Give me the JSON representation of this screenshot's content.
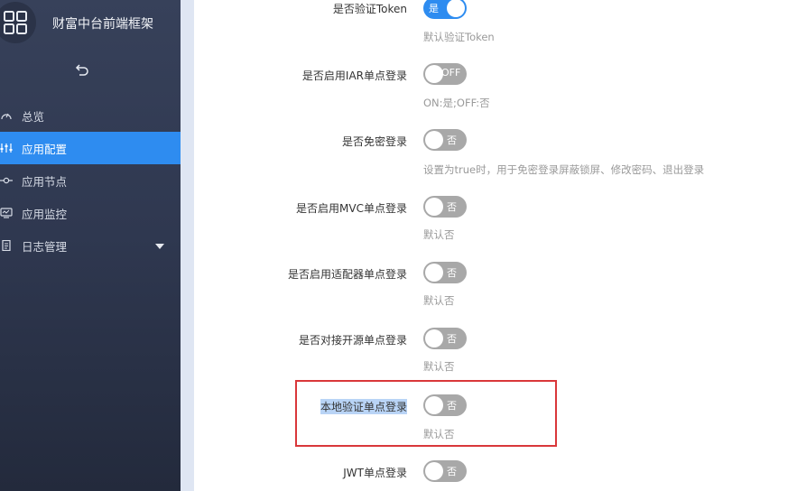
{
  "app": {
    "title": "财富中台前端框架",
    "logo_icon": "grid-app-icon",
    "collapse_icon": "undo-arrow-icon"
  },
  "sidebar": {
    "items": [
      {
        "label": "总览",
        "icon": "dashboard-gauge-icon",
        "active": false
      },
      {
        "label": "应用配置",
        "icon": "sliders-icon",
        "active": true
      },
      {
        "label": "应用节点",
        "icon": "node-icon",
        "active": false
      },
      {
        "label": "应用监控",
        "icon": "monitor-icon",
        "active": false
      },
      {
        "label": "日志管理",
        "icon": "document-icon",
        "active": false,
        "expandable": true
      }
    ]
  },
  "settings": [
    {
      "label": "是否验证Token",
      "switch_text": "是",
      "on": true,
      "hint": "默认验证Token"
    },
    {
      "label": "是否启用IAR单点登录",
      "switch_text": "OFF",
      "on": false,
      "hint": "ON:是;OFF:否"
    },
    {
      "label": "是否免密登录",
      "switch_text": "否",
      "on": false,
      "hint": "设置为true时，用于免密登录屏蔽锁屏、修改密码、退出登录"
    },
    {
      "label": "是否启用MVC单点登录",
      "switch_text": "否",
      "on": false,
      "hint": "默认否"
    },
    {
      "label": "是否启用适配器单点登录",
      "switch_text": "否",
      "on": false,
      "hint": "默认否"
    },
    {
      "label": "是否对接开源单点登录",
      "switch_text": "否",
      "on": false,
      "hint": "默认否"
    },
    {
      "label": "本地验证单点登录",
      "switch_text": "否",
      "on": false,
      "hint": "默认否",
      "selected": true,
      "highlighted": true
    },
    {
      "label": "JWT单点登录",
      "switch_text": "否",
      "on": false
    }
  ],
  "colors": {
    "accent": "#2e8cf0",
    "highlight_border": "#d9373a",
    "switch_off": "#a8a8a8"
  }
}
